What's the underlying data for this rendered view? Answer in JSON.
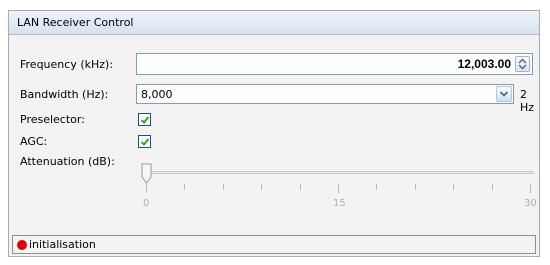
{
  "window": {
    "title": "LAN Receiver Control"
  },
  "frequency": {
    "label": "Frequency (kHz):",
    "value": "12,003.00"
  },
  "bandwidth": {
    "label": "Bandwidth (Hz):",
    "value": "8,000",
    "extra": "2 Hz"
  },
  "preselector": {
    "label": "Preselector:",
    "checked": true
  },
  "agc": {
    "label": "AGC:",
    "checked": true
  },
  "attenuation": {
    "label": "Attenuation (dB):",
    "value": 0,
    "min": 0,
    "max": 30,
    "tick_labels": [
      "0",
      "15",
      "30"
    ]
  },
  "status": {
    "text": "initialisation",
    "color": "#e10000"
  },
  "colors": {
    "titlebar": "#d7e2f1",
    "checkmark": "#21a121",
    "field_border": "#7f9db9"
  }
}
